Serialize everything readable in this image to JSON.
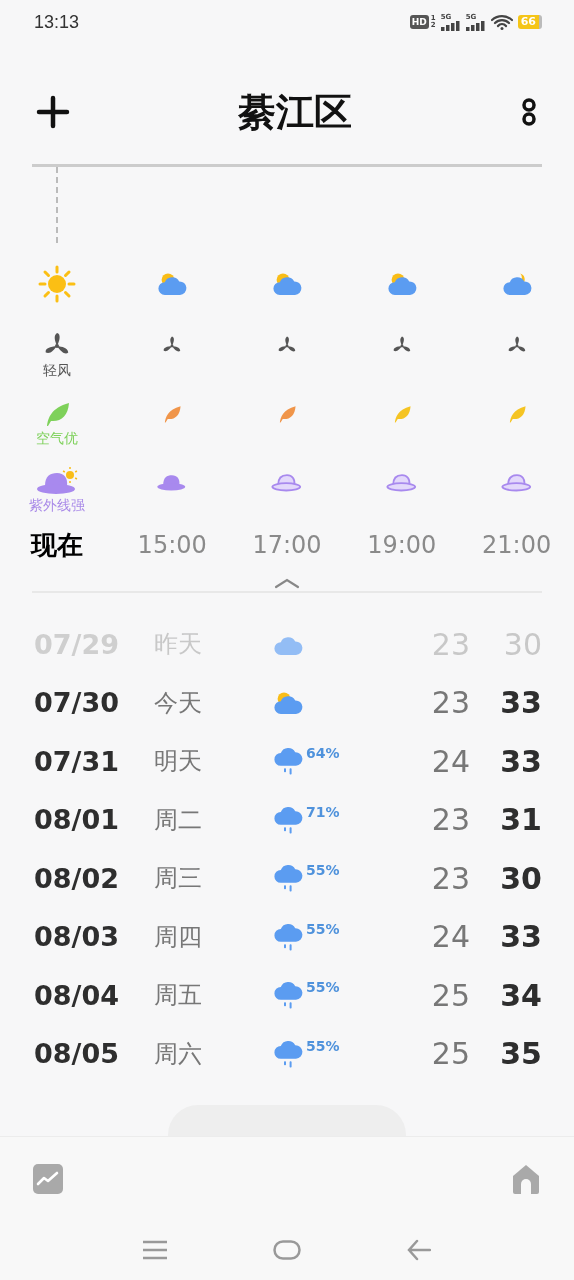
{
  "status_bar": {
    "time": "13:13",
    "hd_badge": "HD",
    "sim_slots": [
      "1",
      "2"
    ],
    "networks": [
      "5G",
      "5G"
    ],
    "battery": "66"
  },
  "header": {
    "title": "綦江区"
  },
  "hourly": {
    "wind_label": "轻风",
    "air_label": "空气优",
    "uv_label": "紫外线强",
    "columns": [
      {
        "time": "现在",
        "selected": true,
        "weather": {
          "kind": "sunny"
        },
        "air": {
          "color": "#7ed15a"
        },
        "uv": {
          "kind": "strong"
        }
      },
      {
        "time": "15:00",
        "selected": false,
        "weather": {
          "kind": "partlycloudy"
        },
        "air": {
          "color": "#f0954a"
        },
        "uv": {
          "kind": "strong"
        }
      },
      {
        "time": "17:00",
        "selected": false,
        "weather": {
          "kind": "partlycloudy"
        },
        "air": {
          "color": "#f0954a"
        },
        "uv": {
          "kind": "moderate"
        }
      },
      {
        "time": "19:00",
        "selected": false,
        "weather": {
          "kind": "partlycloudy"
        },
        "air": {
          "color": "#f5c423"
        },
        "uv": {
          "kind": "moderate"
        }
      },
      {
        "time": "21:00",
        "selected": false,
        "weather": {
          "kind": "night"
        },
        "air": {
          "color": "#f5c423"
        },
        "uv": {
          "kind": "moderate"
        }
      }
    ]
  },
  "daily": [
    {
      "date": "07/29",
      "day": "昨天",
      "icon": {
        "kind": "cloudy"
      },
      "low": "23",
      "high": "30",
      "past": true
    },
    {
      "date": "07/30",
      "day": "今天",
      "icon": {
        "kind": "partlycloudy"
      },
      "low": "23",
      "high": "33",
      "past": false
    },
    {
      "date": "07/31",
      "day": "明天",
      "icon": {
        "kind": "rain"
      },
      "precip": "64%",
      "low": "24",
      "high": "33",
      "past": false
    },
    {
      "date": "08/01",
      "day": "周二",
      "icon": {
        "kind": "rain"
      },
      "precip": "71%",
      "low": "23",
      "high": "31",
      "past": false
    },
    {
      "date": "08/02",
      "day": "周三",
      "icon": {
        "kind": "rain"
      },
      "precip": "55%",
      "low": "23",
      "high": "30",
      "past": false
    },
    {
      "date": "08/03",
      "day": "周四",
      "icon": {
        "kind": "rain"
      },
      "precip": "55%",
      "low": "24",
      "high": "33",
      "past": false
    },
    {
      "date": "08/04",
      "day": "周五",
      "icon": {
        "kind": "rain"
      },
      "precip": "55%",
      "low": "25",
      "high": "34",
      "past": false
    },
    {
      "date": "08/05",
      "day": "周六",
      "icon": {
        "kind": "rain"
      },
      "precip": "55%",
      "low": "25",
      "high": "35",
      "past": false
    }
  ]
}
